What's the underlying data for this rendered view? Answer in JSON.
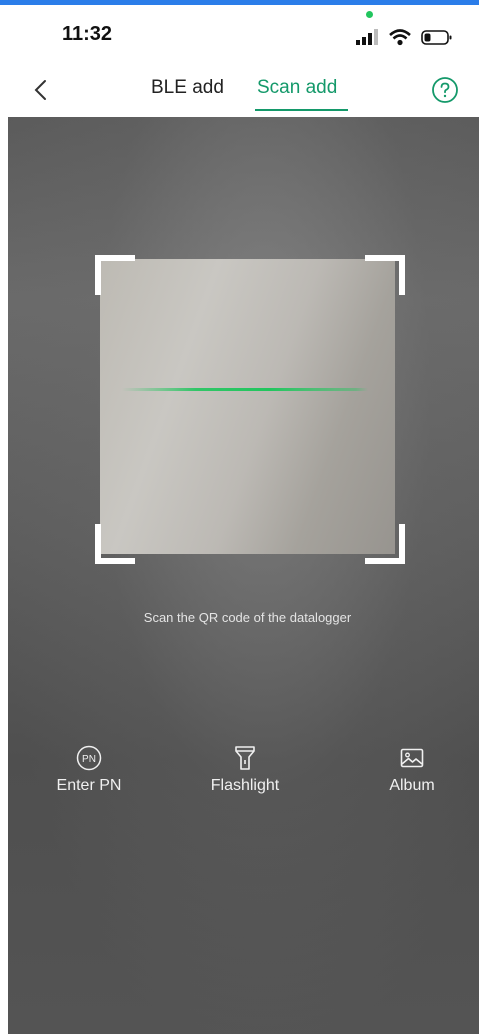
{
  "status_bar": {
    "time": "11:32"
  },
  "nav": {
    "tabs": [
      {
        "label": "BLE add",
        "active": false
      },
      {
        "label": "Scan add",
        "active": true
      }
    ],
    "icons": {
      "back": "chevron-left-icon",
      "help": "question-circle-icon"
    }
  },
  "scanner": {
    "hint": "Scan the QR code of the datalogger"
  },
  "actions": [
    {
      "label": "Enter PN",
      "icon": "pn-circle-icon"
    },
    {
      "label": "Flashlight",
      "icon": "flashlight-icon"
    },
    {
      "label": "Album",
      "icon": "image-icon"
    }
  ],
  "colors": {
    "accent": "#14996a",
    "scan_line": "#22c55e",
    "top_accent": "#2b7de9"
  }
}
